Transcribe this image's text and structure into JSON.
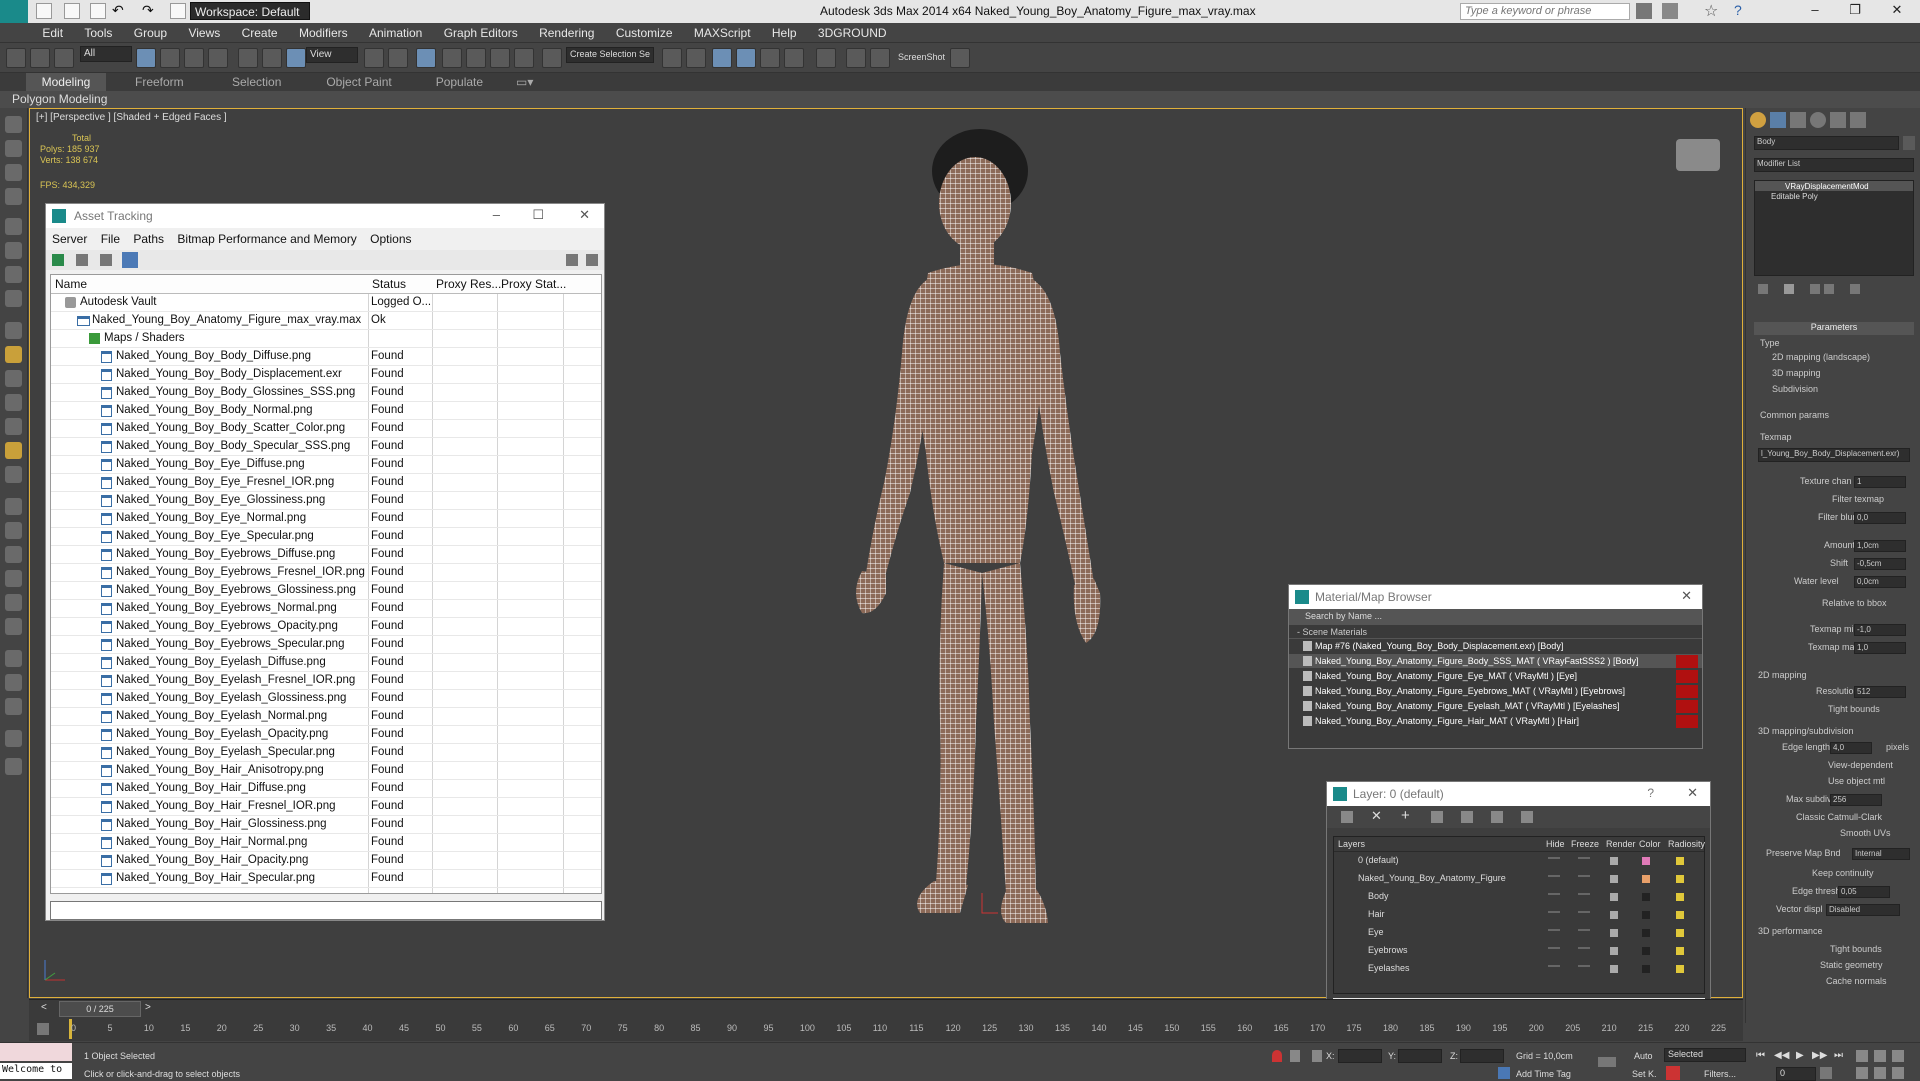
{
  "app": {
    "title": "Autodesk 3ds Max  2014 x64      Naked_Young_Boy_Anatomy_Figure_max_vray.max",
    "workspace": "Workspace: Default",
    "search_placeholder": "Type a keyword or phrase"
  },
  "menu": [
    "Edit",
    "Tools",
    "Group",
    "Views",
    "Create",
    "Modifiers",
    "Animation",
    "Graph Editors",
    "Rendering",
    "Customize",
    "MAXScript",
    "Help",
    "3DGROUND"
  ],
  "toolbar": {
    "selection_filter": "All",
    "ref_coord": "View",
    "selection_set": "Create Selection Se",
    "screenshot": "ScreenShot"
  },
  "ribbon": {
    "tabs": [
      "Modeling",
      "Freeform",
      "Selection",
      "Object Paint",
      "Populate"
    ],
    "active": "Modeling",
    "sub": "Polygon Modeling"
  },
  "viewport": {
    "label": "[+] [Perspective ] [Shaded + Edged Faces ]",
    "stats_total": "Total",
    "stats_polys": "Polys:   185 937",
    "stats_verts": "Verts:   138 674",
    "stats_fps": "FPS:        434,329"
  },
  "asset_tracking": {
    "title": "Asset Tracking",
    "menu": [
      "Server",
      "File",
      "Paths",
      "Bitmap Performance and Memory",
      "Options"
    ],
    "columns": [
      "Name",
      "Status",
      "Proxy Res...",
      "Proxy Stat..."
    ],
    "rows": [
      {
        "name": "Autodesk Vault",
        "status": "Logged O...",
        "indent": 1
      },
      {
        "name": "Naked_Young_Boy_Anatomy_Figure_max_vray.max",
        "status": "Ok",
        "indent": 2
      },
      {
        "name": "Maps / Shaders",
        "status": "",
        "indent": 3
      },
      {
        "name": "Naked_Young_Boy_Body_Diffuse.png",
        "status": "Found",
        "indent": 4
      },
      {
        "name": "Naked_Young_Boy_Body_Displacement.exr",
        "status": "Found",
        "indent": 4
      },
      {
        "name": "Naked_Young_Boy_Body_Glossines_SSS.png",
        "status": "Found",
        "indent": 4
      },
      {
        "name": "Naked_Young_Boy_Body_Normal.png",
        "status": "Found",
        "indent": 4
      },
      {
        "name": "Naked_Young_Boy_Body_Scatter_Color.png",
        "status": "Found",
        "indent": 4
      },
      {
        "name": "Naked_Young_Boy_Body_Specular_SSS.png",
        "status": "Found",
        "indent": 4
      },
      {
        "name": "Naked_Young_Boy_Eye_Diffuse.png",
        "status": "Found",
        "indent": 4
      },
      {
        "name": "Naked_Young_Boy_Eye_Fresnel_IOR.png",
        "status": "Found",
        "indent": 4
      },
      {
        "name": "Naked_Young_Boy_Eye_Glossiness.png",
        "status": "Found",
        "indent": 4
      },
      {
        "name": "Naked_Young_Boy_Eye_Normal.png",
        "status": "Found",
        "indent": 4
      },
      {
        "name": "Naked_Young_Boy_Eye_Specular.png",
        "status": "Found",
        "indent": 4
      },
      {
        "name": "Naked_Young_Boy_Eyebrows_Diffuse.png",
        "status": "Found",
        "indent": 4
      },
      {
        "name": "Naked_Young_Boy_Eyebrows_Fresnel_IOR.png",
        "status": "Found",
        "indent": 4
      },
      {
        "name": "Naked_Young_Boy_Eyebrows_Glossiness.png",
        "status": "Found",
        "indent": 4
      },
      {
        "name": "Naked_Young_Boy_Eyebrows_Normal.png",
        "status": "Found",
        "indent": 4
      },
      {
        "name": "Naked_Young_Boy_Eyebrows_Opacity.png",
        "status": "Found",
        "indent": 4
      },
      {
        "name": "Naked_Young_Boy_Eyebrows_Specular.png",
        "status": "Found",
        "indent": 4
      },
      {
        "name": "Naked_Young_Boy_Eyelash_Diffuse.png",
        "status": "Found",
        "indent": 4
      },
      {
        "name": "Naked_Young_Boy_Eyelash_Fresnel_IOR.png",
        "status": "Found",
        "indent": 4
      },
      {
        "name": "Naked_Young_Boy_Eyelash_Glossiness.png",
        "status": "Found",
        "indent": 4
      },
      {
        "name": "Naked_Young_Boy_Eyelash_Normal.png",
        "status": "Found",
        "indent": 4
      },
      {
        "name": "Naked_Young_Boy_Eyelash_Opacity.png",
        "status": "Found",
        "indent": 4
      },
      {
        "name": "Naked_Young_Boy_Eyelash_Specular.png",
        "status": "Found",
        "indent": 4
      },
      {
        "name": "Naked_Young_Boy_Hair_Anisotropy.png",
        "status": "Found",
        "indent": 4
      },
      {
        "name": "Naked_Young_Boy_Hair_Diffuse.png",
        "status": "Found",
        "indent": 4
      },
      {
        "name": "Naked_Young_Boy_Hair_Fresnel_IOR.png",
        "status": "Found",
        "indent": 4
      },
      {
        "name": "Naked_Young_Boy_Hair_Glossiness.png",
        "status": "Found",
        "indent": 4
      },
      {
        "name": "Naked_Young_Boy_Hair_Normal.png",
        "status": "Found",
        "indent": 4
      },
      {
        "name": "Naked_Young_Boy_Hair_Opacity.png",
        "status": "Found",
        "indent": 4
      },
      {
        "name": "Naked_Young_Boy_Hair_Specular.png",
        "status": "Found",
        "indent": 4
      }
    ]
  },
  "material_browser": {
    "title": "Material/Map Browser",
    "search": "Search by Name ...",
    "section": "- Scene Materials",
    "items": [
      {
        "label": "Map #76 (Naked_Young_Boy_Body_Displacement.exr) [Body]",
        "red": false
      },
      {
        "label": "Naked_Young_Boy_Anatomy_Figure_Body_SSS_MAT ( VRayFastSSS2 ) [Body]",
        "red": true
      },
      {
        "label": "Naked_Young_Boy_Anatomy_Figure_Eye_MAT ( VRayMtl ) [Eye]",
        "red": true
      },
      {
        "label": "Naked_Young_Boy_Anatomy_Figure_Eyebrows_MAT ( VRayMtl ) [Eyebrows]",
        "red": true
      },
      {
        "label": "Naked_Young_Boy_Anatomy_Figure_Eyelash_MAT ( VRayMtl ) [Eyelashes]",
        "red": true
      },
      {
        "label": "Naked_Young_Boy_Anatomy_Figure_Hair_MAT ( VRayMtl ) [Hair]",
        "red": true
      }
    ]
  },
  "layer_window": {
    "title": "Layer: 0 (default)",
    "help": "?",
    "columns": [
      "Layers",
      "Hide",
      "Freeze",
      "Render",
      "Color",
      "Radiosity"
    ],
    "rows": [
      {
        "name": "0 (default)",
        "indent": 0
      },
      {
        "name": "Naked_Young_Boy_Anatomy_Figure",
        "indent": 0
      },
      {
        "name": "Body",
        "indent": 1
      },
      {
        "name": "Hair",
        "indent": 1
      },
      {
        "name": "Eye",
        "indent": 1
      },
      {
        "name": "Eyebrows",
        "indent": 1
      },
      {
        "name": "Eyelashes",
        "indent": 1
      }
    ]
  },
  "command_panel": {
    "object_name": "Body",
    "modifier_list": "Modifier List",
    "stack": [
      "VRayDisplacementMod",
      "Editable Poly"
    ],
    "parameters": "Parameters",
    "type_label": "Type",
    "type_options": [
      "2D mapping (landscape)",
      "3D mapping",
      "Subdivision"
    ],
    "common_params": "Common params",
    "texmap_label": "Texmap",
    "texmap_value": "l_Young_Boy_Body_Displacement.exr)",
    "texture_chan_label": "Texture chan",
    "texture_chan": "1",
    "filter_texmap": "Filter texmap",
    "filter_blur_label": "Filter blur",
    "filter_blur": "0,0",
    "amount_label": "Amount",
    "amount": "1,0cm",
    "shift_label": "Shift",
    "shift": "-0,5cm",
    "water_level_label": "Water level",
    "water_level": "0,0cm",
    "relative_bbox": "Relative to bbox",
    "texmap_min_label": "Texmap min",
    "texmap_min": "-1,0",
    "texmap_max_label": "Texmap max",
    "texmap_max": "1,0",
    "mapping2d": "2D mapping",
    "resolution_label": "Resolution",
    "resolution": "512",
    "tight_bounds": "Tight bounds",
    "mapping3d": "3D mapping/subdivision",
    "edge_length_label": "Edge length",
    "edge_length": "4,0",
    "pixels": "pixels",
    "view_dependent": "View-dependent",
    "use_object_mtl": "Use object mtl",
    "max_subdivs_label": "Max subdivs",
    "max_subdivs": "256",
    "classic_catmull": "Classic Catmull-Clark",
    "smooth_uvs": "Smooth UVs",
    "preserve_map_bnd": "Preserve Map Bnd",
    "preserve_map_value": "Internal",
    "keep_continuity": "Keep continuity",
    "edge_thresh_label": "Edge thresh",
    "edge_thresh": "0,05",
    "vector_disp_label": "Vector displ",
    "vector_disp": "Disabled",
    "performance": "3D performance",
    "tight_bounds2": "Tight bounds",
    "static_geometry": "Static geometry",
    "cache_normals": "Cache normals"
  },
  "timeline": {
    "frame": "0 / 225",
    "ticks": [
      "0",
      "5",
      "10",
      "15",
      "20",
      "25",
      "30",
      "35",
      "40",
      "45",
      "50",
      "55",
      "60",
      "65",
      "70",
      "75",
      "80",
      "85",
      "90",
      "95",
      "100",
      "105",
      "110",
      "115",
      "120",
      "125",
      "130",
      "135",
      "140",
      "145",
      "150",
      "155",
      "160",
      "165",
      "170",
      "175",
      "180",
      "185",
      "190",
      "195",
      "200",
      "205",
      "210",
      "215",
      "220",
      "225"
    ]
  },
  "status": {
    "listener": "Welcome to",
    "selected": "1 Object Selected",
    "hint": "Click or click-and-drag to select objects",
    "x_label": "X:",
    "y_label": "Y:",
    "z_label": "Z:",
    "grid": "Grid = 10,0cm",
    "add_time_tag": "Add Time Tag",
    "auto": "Auto",
    "set_k": "Set K.",
    "selected_dd": "Selected",
    "filters": "Filters...",
    "frame_field": "0"
  }
}
